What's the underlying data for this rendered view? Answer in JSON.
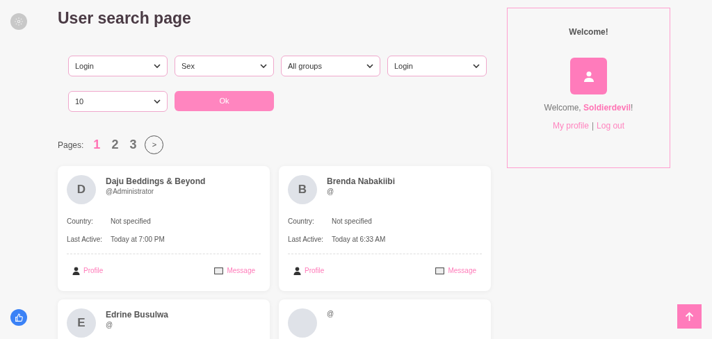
{
  "title": "User search page",
  "filters": [
    {
      "value": "Login"
    },
    {
      "value": "Sex"
    },
    {
      "value": "All groups"
    },
    {
      "value": "Login"
    },
    {
      "value": "10"
    }
  ],
  "ok_button": "Ok",
  "pagination": {
    "label": "Pages:",
    "pages": [
      {
        "label": "1",
        "selected": true
      },
      {
        "label": "2",
        "selected": false
      },
      {
        "label": "3",
        "selected": false
      }
    ],
    "next": ">"
  },
  "users": [
    {
      "initial": "D",
      "name": "Daju Beddings & Beyond",
      "handle": "@Administrator",
      "fields": [
        {
          "label": "Country:",
          "value": "Not specified"
        },
        {
          "label": "Last Active:",
          "value": "Today at 7:00 PM"
        }
      ],
      "actions": [
        "Profile",
        "Message"
      ]
    },
    {
      "initial": "B",
      "name": "Brenda Nabakiibi",
      "handle": "@",
      "fields": [
        {
          "label": "Country:",
          "value": "Not specified"
        },
        {
          "label": "Last Active:",
          "value": "Today at 6:33 AM"
        }
      ],
      "actions": [
        "Profile",
        "Message"
      ]
    },
    {
      "initial": "E",
      "name": "Edrine Busulwa",
      "handle": "@"
    },
    {
      "handle": "@"
    }
  ],
  "welcome_panel": {
    "title": "Welcome!",
    "greeting": "Welcome, **Soldierdevil**!",
    "links": [
      "My profile",
      "Log out"
    ],
    "separator": "|"
  }
}
